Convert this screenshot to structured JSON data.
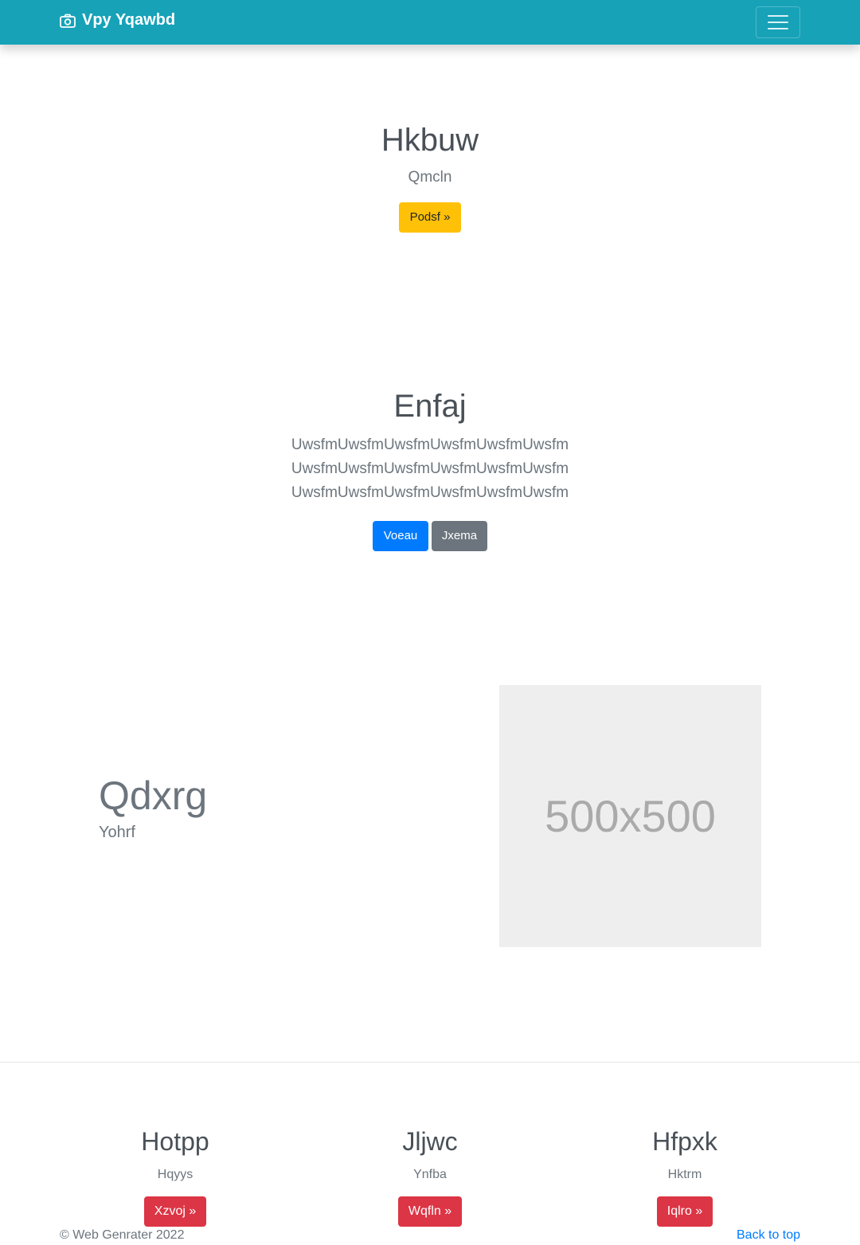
{
  "navbar": {
    "brand": "Vpy Yqawbd",
    "brand_icon": "camera-icon",
    "toggler_icon": "hamburger-icon"
  },
  "hero": {
    "title": "Hkbuw",
    "subtitle": "Qmcln",
    "button": "Podsf »"
  },
  "section2": {
    "title": "Enfaj",
    "lines": [
      "UwsfmUwsfmUwsfmUwsfmUwsfmUwsfm",
      "UwsfmUwsfmUwsfmUwsfmUwsfmUwsfm",
      "UwsfmUwsfmUwsfmUwsfmUwsfmUwsfm"
    ],
    "primary_button": "Voeau",
    "secondary_button": "Jxema"
  },
  "feature": {
    "title": "Qdxrg",
    "subtitle": "Yohrf",
    "image_label": "500x500"
  },
  "columns": [
    {
      "title": "Hotpp",
      "text": "Hqyys",
      "button": "Xzvoj »"
    },
    {
      "title": "Jljwc",
      "text": "Ynfba",
      "button": "Wqfln »"
    },
    {
      "title": "Hfpxk",
      "text": "Hktrm",
      "button": "Iqlro »"
    }
  ],
  "footer": {
    "copyright": "© Web Genrater 2022",
    "back_to_top": "Back to top"
  },
  "colors": {
    "navbar": "#17a2b8",
    "warning": "#ffc107",
    "primary": "#007bff",
    "secondary": "#6c757d",
    "danger": "#dc3545"
  }
}
